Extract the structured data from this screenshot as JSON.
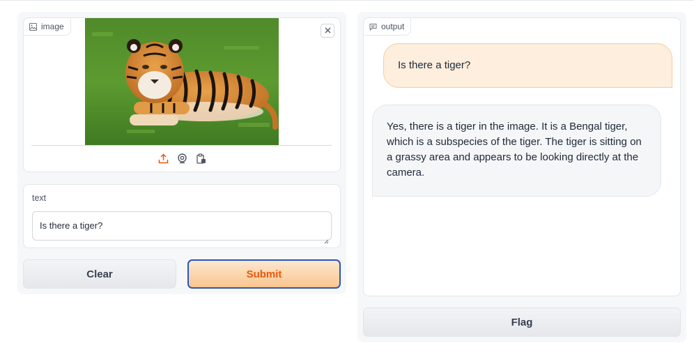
{
  "input_panel": {
    "image_block": {
      "label": "image",
      "icon": "image-icon",
      "close_icon": "close-icon",
      "source_icons": [
        "upload-icon",
        "webcam-icon",
        "clipboard-icon"
      ]
    },
    "text_block": {
      "label": "text",
      "value": "Is there a tiger?"
    },
    "clear_label": "Clear",
    "submit_label": "Submit"
  },
  "output_panel": {
    "label": "output",
    "icon": "chat-icon",
    "messages": [
      {
        "role": "user",
        "text": "Is there a tiger?"
      },
      {
        "role": "bot",
        "text": "Yes, there is a tiger in the image. It is a Bengal tiger, which is a subspecies of the tiger. The tiger is sitting on a grassy area and appears to be looking directly at the camera."
      }
    ],
    "flag_label": "Flag"
  },
  "colors": {
    "accent": "#ea580c",
    "submit_border": "#2a56b7",
    "user_bubble": "#fdeedd",
    "bot_bubble": "#f4f6f8"
  }
}
